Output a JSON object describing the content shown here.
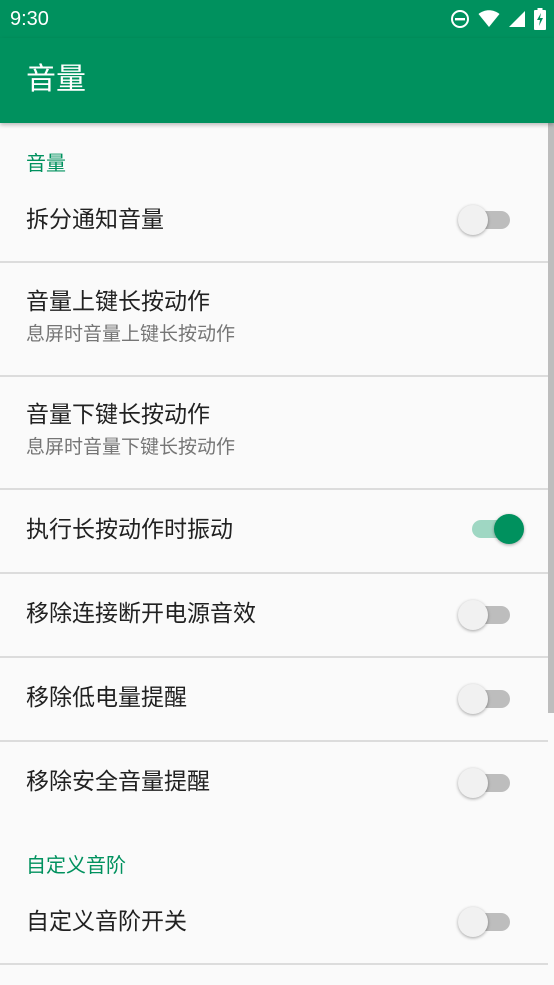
{
  "status_bar": {
    "time": "9:30",
    "icons": [
      "do-not-disturb-icon",
      "wifi-icon",
      "signal-icon",
      "battery-charging-icon"
    ]
  },
  "app_bar": {
    "title": "音量"
  },
  "sections": {
    "volume": {
      "header": "音量",
      "items": [
        {
          "title": "拆分通知音量",
          "switch_on": false
        },
        {
          "title": "音量上键长按动作",
          "summary": "息屏时音量上键长按动作"
        },
        {
          "title": "音量下键长按动作",
          "summary": "息屏时音量下键长按动作"
        },
        {
          "title": "执行长按动作时振动",
          "switch_on": true
        },
        {
          "title": "移除连接断开电源音效",
          "switch_on": false
        },
        {
          "title": "移除低电量提醒",
          "switch_on": false
        },
        {
          "title": "移除安全音量提醒",
          "switch_on": false
        }
      ]
    },
    "custom_scale": {
      "header": "自定义音阶",
      "items": [
        {
          "title": "自定义音阶开关",
          "switch_on": false
        }
      ]
    }
  },
  "colors": {
    "accent": "#00915e",
    "switch_on_track": "#9fd7c3",
    "switch_off_thumb": "#f1f1f1",
    "switch_off_track": "#bdbdbd"
  }
}
